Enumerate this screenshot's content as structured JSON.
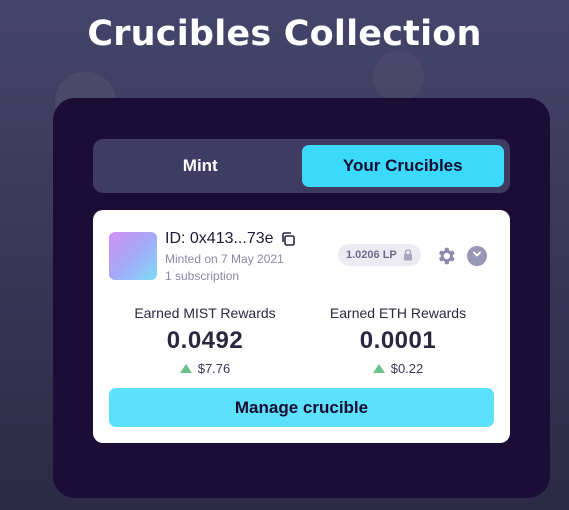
{
  "page": {
    "title": "Crucibles Collection"
  },
  "tabs": [
    {
      "label": "Mint",
      "active": false
    },
    {
      "label": "Your Crucibles",
      "active": true
    }
  ],
  "crucible": {
    "id": "ID: 0x413...73e",
    "minted": "Minted on 7 May 2021",
    "subscriptions": "1 subscription",
    "lp_badge": "1.0206 LP",
    "rewards": {
      "mist": {
        "label": "Earned MIST Rewards",
        "value": "0.0492",
        "usd": "$7.76"
      },
      "eth": {
        "label": "Earned ETH Rewards",
        "value": "0.0001",
        "usd": "$0.22"
      }
    },
    "manage_label": "Manage crucible"
  },
  "colors": {
    "accent": "#3bd9fb",
    "panel": "#1b0d35",
    "positive": "#6cc08c"
  },
  "icons": [
    "copy-icon",
    "lock-icon",
    "gear-icon",
    "chevron-down-icon"
  ]
}
